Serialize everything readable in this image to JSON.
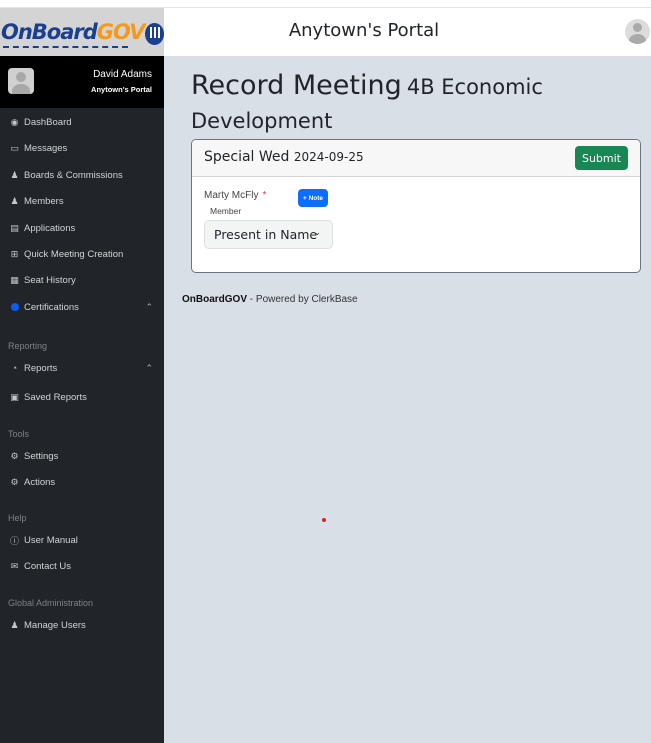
{
  "header": {
    "logo": {
      "part1": "OnBoard",
      "part2": "GOV"
    },
    "portal_title": "Anytown's Portal"
  },
  "user": {
    "name": "David Adams",
    "portal": "Anytown's Portal"
  },
  "sidebar": {
    "items": [
      {
        "label": "DashBoard",
        "icon": "dashboard-icon"
      },
      {
        "label": "Messages",
        "icon": "inbox-icon"
      },
      {
        "label": "Boards & Commissions",
        "icon": "users-icon"
      },
      {
        "label": "Members",
        "icon": "user-icon"
      },
      {
        "label": "Applications",
        "icon": "id-card-icon"
      },
      {
        "label": "Quick Meeting Creation",
        "icon": "calendar-plus-icon"
      },
      {
        "label": "Seat History",
        "icon": "calendar-icon"
      },
      {
        "label": "Certifications",
        "icon": "blue-dot-icon"
      }
    ],
    "sections": {
      "reporting": {
        "title": "Reporting",
        "items": [
          {
            "label": "Reports",
            "icon": "pie-chart-icon"
          },
          {
            "label": "Saved Reports",
            "icon": "save-icon"
          }
        ]
      },
      "tools": {
        "title": "Tools",
        "items": [
          {
            "label": "Settings",
            "icon": "gear-icon"
          },
          {
            "label": "Actions",
            "icon": "gears-icon"
          }
        ]
      },
      "help": {
        "title": "Help",
        "items": [
          {
            "label": "User Manual",
            "icon": "info-icon"
          },
          {
            "label": "Contact Us",
            "icon": "envelope-icon"
          }
        ]
      },
      "global": {
        "title": "Global Administration",
        "items": [
          {
            "label": "Manage Users",
            "icon": "user-icon"
          }
        ]
      }
    }
  },
  "main": {
    "title": "Record Meeting",
    "subtitle": "4B Economic",
    "subtitle2": "Development",
    "meeting": {
      "name": "Special Wed",
      "date": "2024-09-25",
      "submit_label": "Submit"
    },
    "attendee": {
      "name": "Marty McFly",
      "required_mark": "*",
      "note_label": "+ Note",
      "role": "Member",
      "status": "Present in Name"
    }
  },
  "footer": {
    "brand": "OnBoardGOV",
    "text": " - Powered by ClerkBase"
  },
  "colors": {
    "sidebar_bg": "#212529",
    "main_bg": "#d8dfe7",
    "submit": "#198754",
    "note": "#0d6efd",
    "logo_blue": "#1a3f8f",
    "logo_orange": "#f39a1c"
  }
}
